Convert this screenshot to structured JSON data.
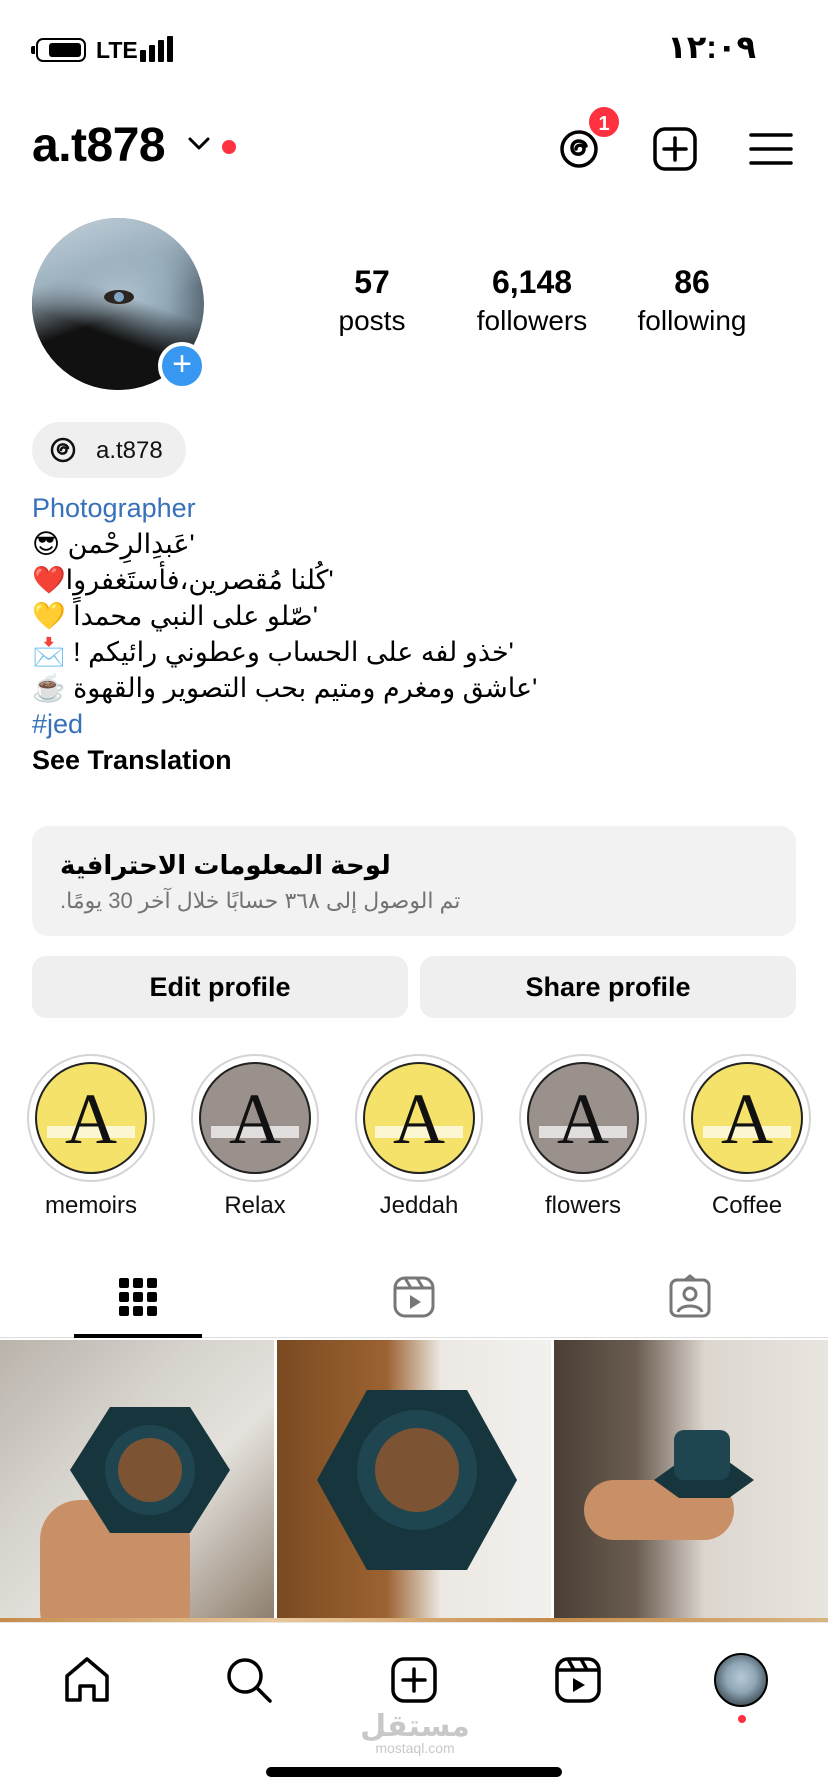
{
  "status_bar": {
    "network": "LTE",
    "time": "١٢:٠٩"
  },
  "header": {
    "username": "a.t878",
    "notification_count": "1"
  },
  "profile": {
    "stats": [
      {
        "value": "57",
        "label": "posts"
      },
      {
        "value": "6,148",
        "label": "followers"
      },
      {
        "value": "86",
        "label": "following"
      }
    ],
    "threads_handle": "a.t878",
    "bio": {
      "category": "Photographer",
      "lines": [
        "'عَبدِالرِحْمن 😎",
        "'كُلنا مُقصرين،فأستَغفروا❤️",
        "'صّلو على النبي محمداً 💛",
        "'خذو لفه على الحساب وعطوني رائيكم ! 📩",
        "'عاشق ومغرم ومتيم بحب التصوير والقهوة ☕️"
      ],
      "hashtag": "#jed",
      "translate": "See Translation"
    }
  },
  "dashboard": {
    "title": "لوحة المعلومات الاحترافية",
    "subtitle": "تم الوصول إلى ٣٦٨ حسابًا خلال آخر 30 يومًا."
  },
  "buttons": {
    "edit": "Edit profile",
    "share": "Share profile"
  },
  "highlights": [
    {
      "label": "memoirs",
      "letter": "A"
    },
    {
      "label": "Relax",
      "letter": "A"
    },
    {
      "label": "Jeddah",
      "letter": "A"
    },
    {
      "label": "flowers",
      "letter": "A"
    },
    {
      "label": "Coffee",
      "letter": "A"
    }
  ],
  "watermark": {
    "arabic": "مستقل",
    "latin": "mostaql.com"
  },
  "colors": {
    "accent": "#3897f0",
    "notification": "#ff3040",
    "link": "#3871b9",
    "highlight_yellow": "#f4e26b",
    "highlight_gray": "#9a918d"
  },
  "icons": {
    "header": [
      "threads-icon",
      "add-post-icon",
      "menu-icon"
    ],
    "tabs": [
      "grid-icon",
      "reels-icon",
      "tagged-icon"
    ],
    "nav": [
      "home-icon",
      "search-icon",
      "create-icon",
      "reels-icon",
      "profile-avatar"
    ]
  }
}
